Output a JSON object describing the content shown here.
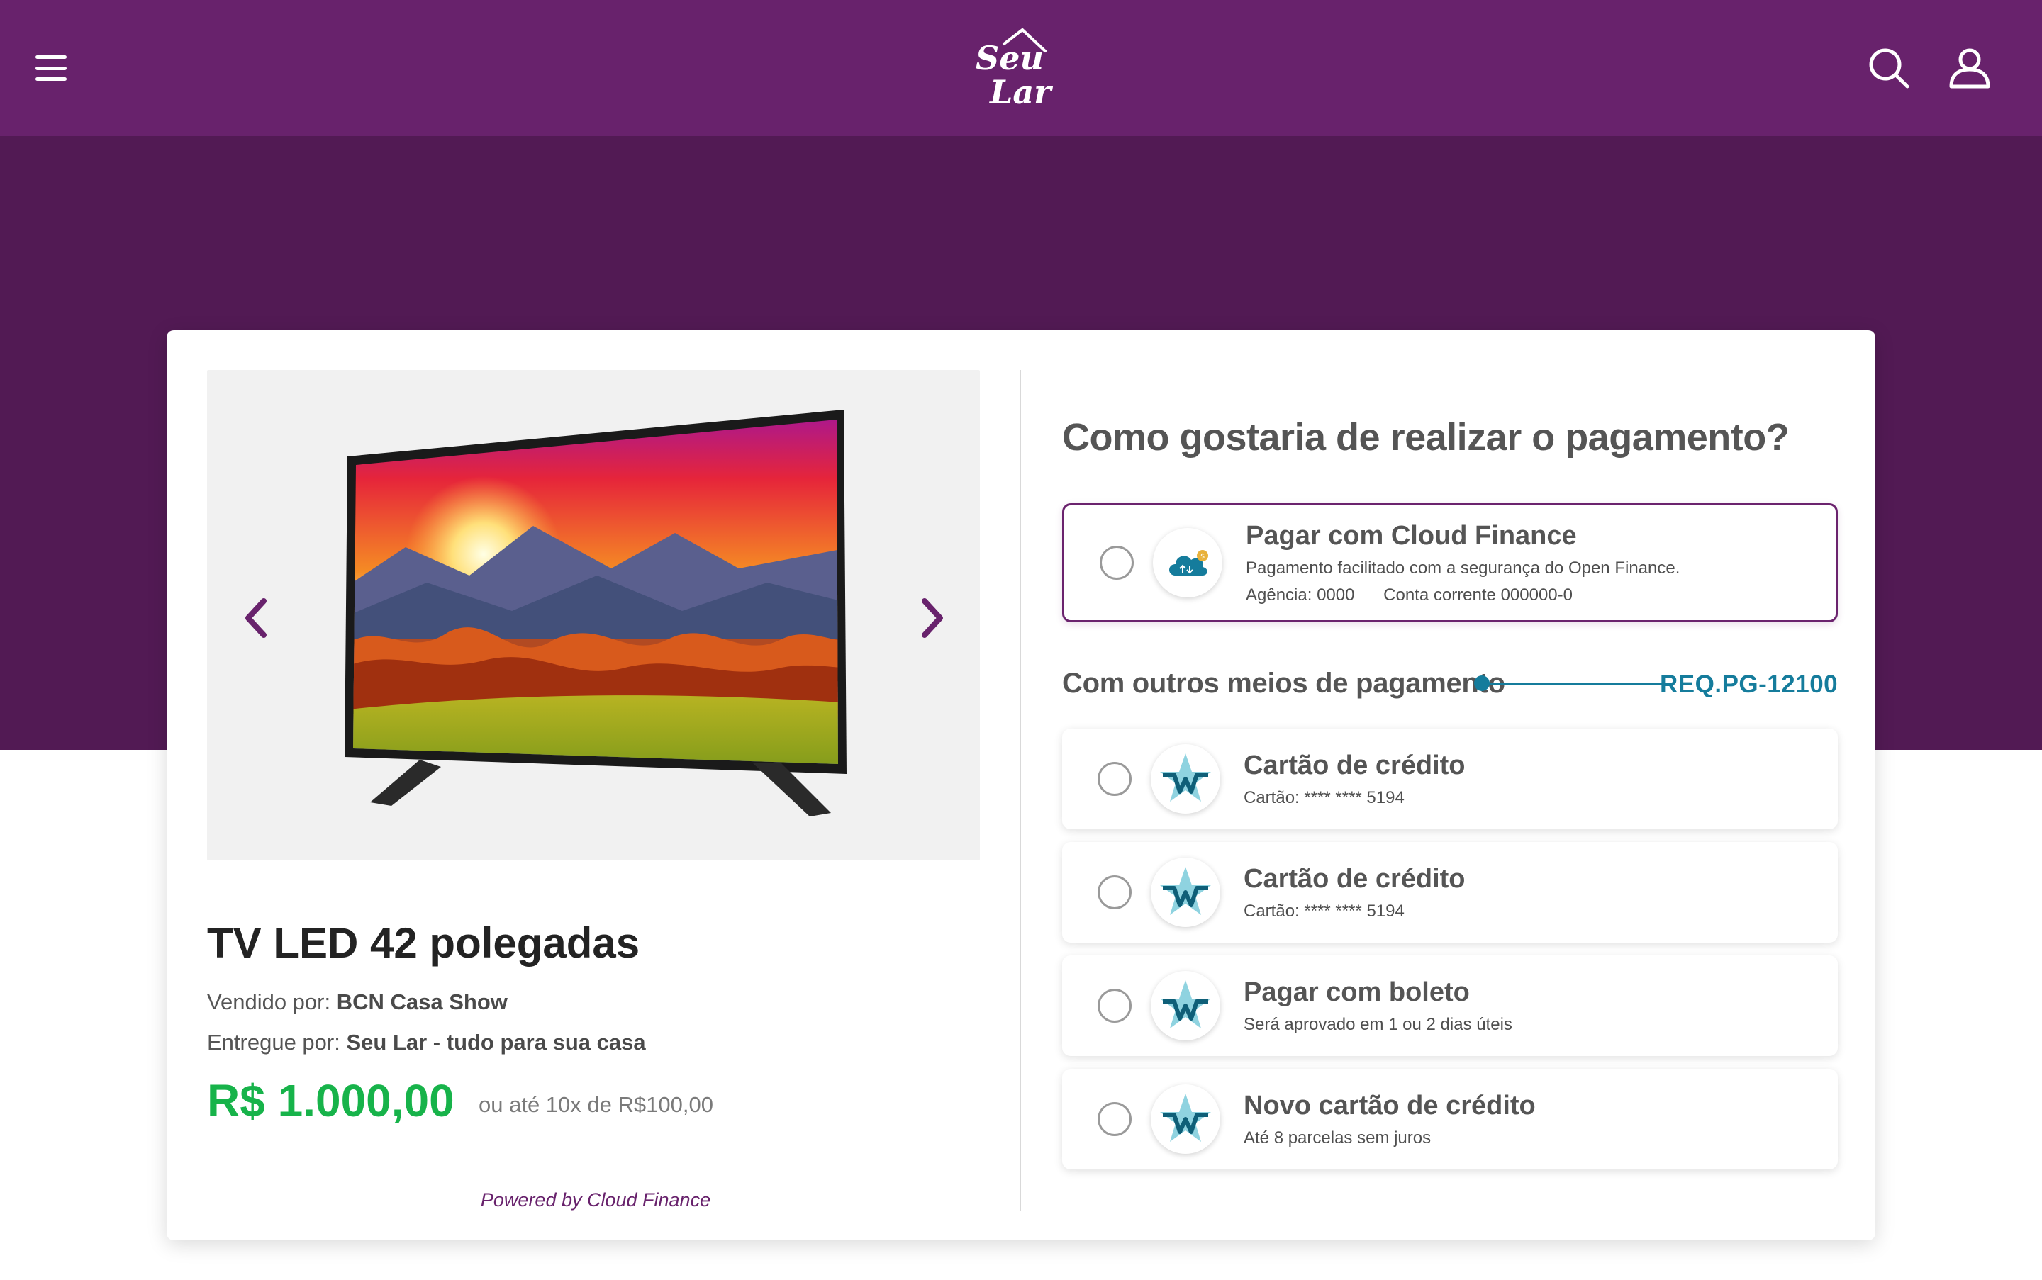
{
  "header": {
    "brand_line1": "Seu",
    "brand_line2": "Lar"
  },
  "product": {
    "title": "TV LED 42 polegadas",
    "seller_label": "Vendido por:",
    "seller": "BCN Casa Show",
    "delivery_label": "Entregue por:",
    "delivery": "Seu Lar - tudo para sua casa",
    "price": "R$ 1.000,00",
    "installments": "ou até 10x de R$100,00",
    "powered_by": "Powered by Cloud Finance"
  },
  "payment": {
    "title": "Como gostaria de realizar o pagamento?",
    "featured": {
      "title": "Pagar com Cloud Finance",
      "subtitle": "Pagamento facilitado com a segurança do Open Finance.",
      "agency": "Agência: 0000",
      "account": "Conta corrente 000000-0",
      "icon": "cloud-finance-icon"
    },
    "other_label": "Com outros meios de pagamento",
    "req_code": "REQ.PG-12100",
    "options": [
      {
        "title": "Cartão de crédito",
        "subtitle": "Cartão: **** **** 5194",
        "icon": "star-logo-icon"
      },
      {
        "title": "Cartão de crédito",
        "subtitle": "Cartão: **** **** 5194",
        "icon": "star-logo-icon"
      },
      {
        "title": "Pagar com boleto",
        "subtitle": "Será aprovado em 1 ou 2 dias úteis",
        "icon": "star-logo-icon"
      },
      {
        "title": "Novo cartão de crédito",
        "subtitle": "Até 8 parcelas sem juros",
        "icon": "star-logo-icon"
      }
    ]
  },
  "colors": {
    "header": "#68226c",
    "band": "#521a54",
    "price": "#17b34a",
    "accent": "#157c9c"
  }
}
